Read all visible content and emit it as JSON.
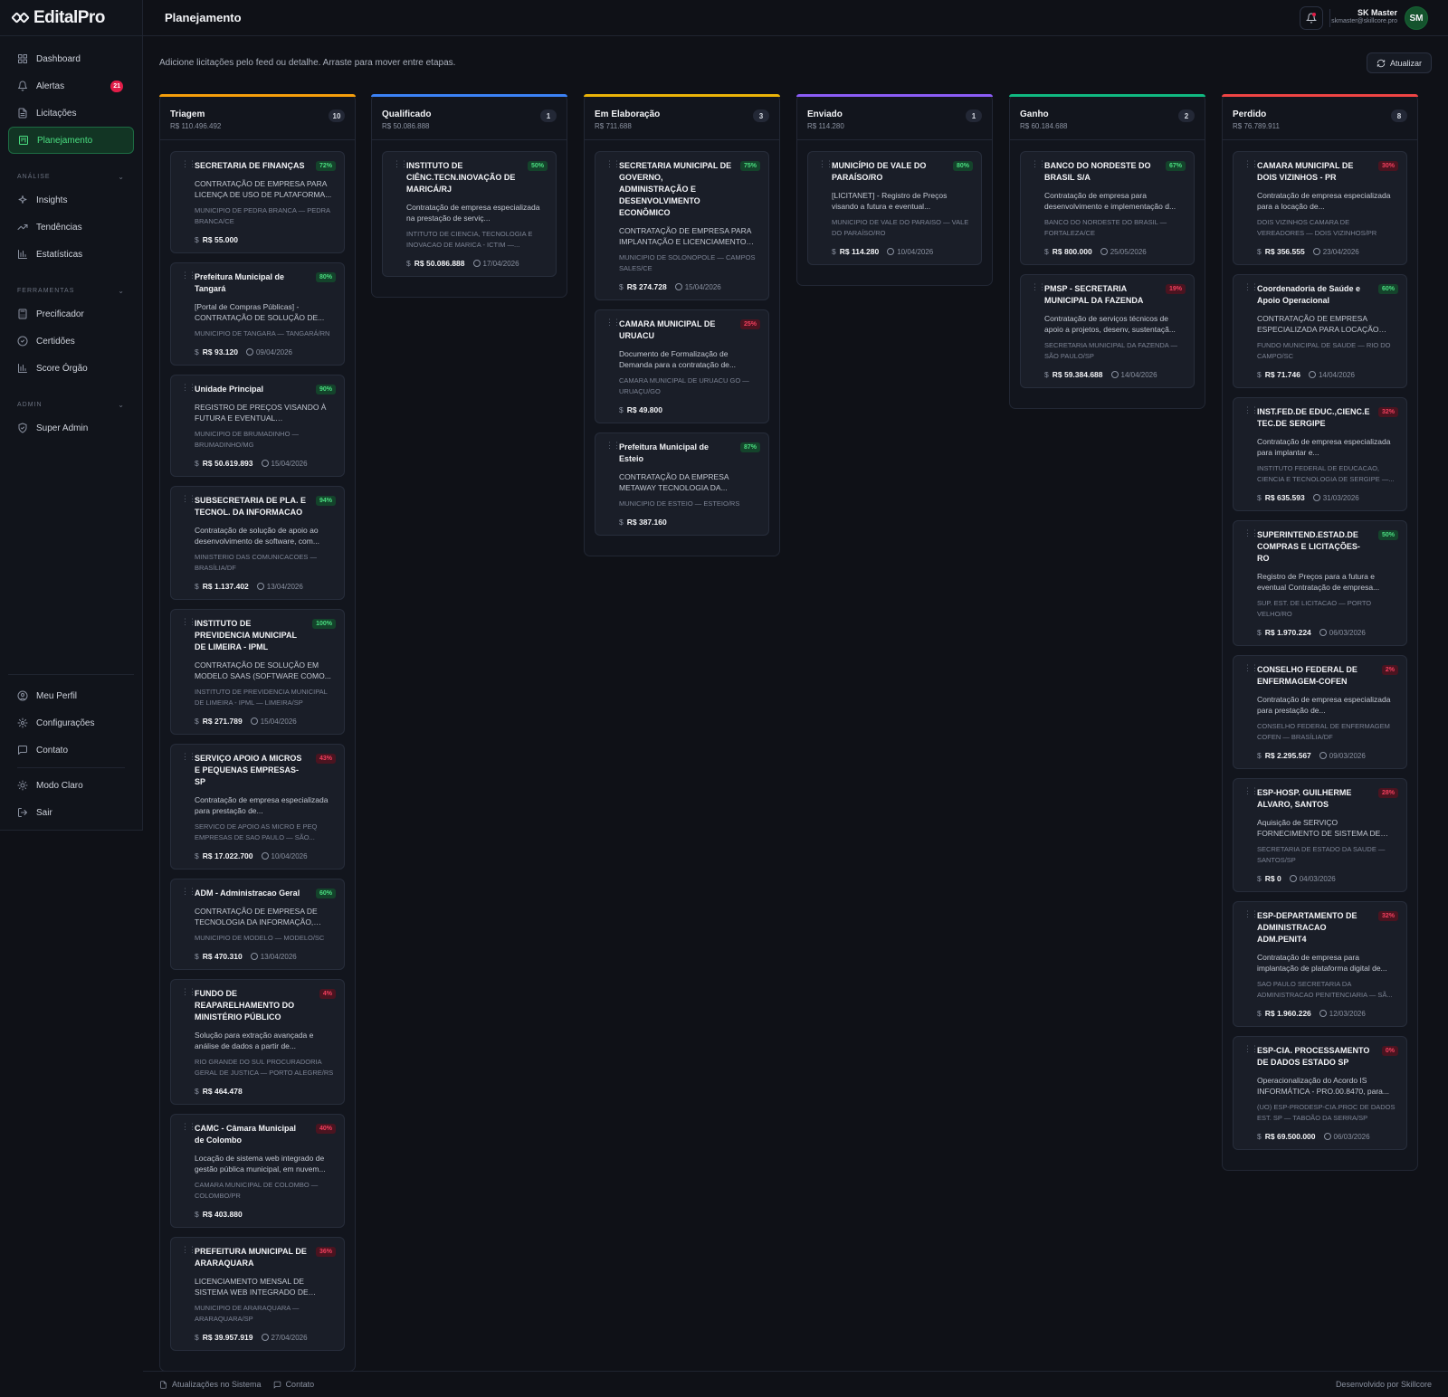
{
  "app": {
    "logo_text": "EditalPro",
    "page_title": "Planejamento"
  },
  "sidebar": {
    "main_items": [
      {
        "label": "Dashboard",
        "icon": "grid-icon"
      },
      {
        "label": "Alertas",
        "icon": "bell-icon",
        "badge": "21"
      },
      {
        "label": "Licitações",
        "icon": "document-icon"
      },
      {
        "label": "Planejamento",
        "icon": "kanban-icon",
        "active": true
      }
    ],
    "analise_title": "ANÁLISE",
    "analise_items": [
      {
        "label": "Insights",
        "icon": "sparkle-icon"
      },
      {
        "label": "Tendências",
        "icon": "trend-icon"
      },
      {
        "label": "Estatísticas",
        "icon": "bar-chart-icon"
      }
    ],
    "ferramentas_title": "FERRAMENTAS",
    "ferramentas_items": [
      {
        "label": "Precificador",
        "icon": "calculator-icon"
      },
      {
        "label": "Certidões",
        "icon": "check-circle-icon"
      },
      {
        "label": "Score Órgão",
        "icon": "bar-chart-icon"
      }
    ],
    "admin_title": "ADMIN",
    "admin_items": [
      {
        "label": "Super Admin",
        "icon": "shield-icon"
      }
    ],
    "bottom_items": [
      {
        "label": "Meu Perfil",
        "icon": "user-circle-icon"
      },
      {
        "label": "Configurações",
        "icon": "gear-icon"
      },
      {
        "label": "Contato",
        "icon": "message-icon"
      }
    ],
    "bottom_items_2": [
      {
        "label": "Modo Claro",
        "icon": "sun-icon"
      },
      {
        "label": "Sair",
        "icon": "logout-icon"
      }
    ]
  },
  "header": {
    "user_name": "SK Master",
    "user_email": "skmaster@skillcore.pro",
    "avatar_initials": "SM"
  },
  "main": {
    "subtitle": "Adicione licitações pelo feed ou detalhe. Arraste para mover entre etapas.",
    "refresh_label": "Atualizar"
  },
  "columns": [
    {
      "name": "Triagem",
      "total": "R$ 110.496.492",
      "count": "10",
      "color": "#f59e0b",
      "cards": [
        {
          "title": "SECRETARIA DE FINANÇAS",
          "pct": "72%",
          "tone": "g",
          "desc": "CONTRATAÇÃO DE EMPRESA PARA LICENÇA DE USO DE PLATAFORMA...",
          "org": "MUNICIPIO DE PEDRA BRANCA — PEDRA BRANCA/CE",
          "value": "R$ 55.000",
          "date": ""
        },
        {
          "title": "Prefeitura Municipal de Tangará",
          "pct": "80%",
          "tone": "g",
          "desc": "[Portal de Compras Públicas] - CONTRATAÇÃO DE SOLUÇÃO DE...",
          "org": "MUNICIPIO DE TANGARA — TANGARÁ/RN",
          "value": "R$ 93.120",
          "date": "09/04/2026"
        },
        {
          "title": "Unidade Principal",
          "pct": "90%",
          "tone": "g",
          "desc": "REGISTRO DE PREÇOS VISANDO À FUTURA E EVENTUAL CONTRATAÇÃO...",
          "org": "MUNICIPIO DE BRUMADINHO — BRUMADINHO/MG",
          "value": "R$ 50.619.893",
          "date": "15/04/2026"
        },
        {
          "title": "SUBSECRETARIA DE PLA. E TECNOL. DA INFORMACAO",
          "pct": "94%",
          "tone": "g",
          "desc": "Contratação de solução de apoio ao desenvolvimento de software, com...",
          "org": "MINISTERIO DAS COMUNICACOES — BRASÍLIA/DF",
          "value": "R$ 1.137.402",
          "date": "13/04/2026"
        },
        {
          "title": "INSTITUTO DE PREVIDENCIA MUNICIPAL DE LIMEIRA - IPML",
          "pct": "100%",
          "tone": "g",
          "desc": "CONTRATAÇÃO DE SOLUÇÃO EM MODELO SAAS (SOFTWARE COMO...",
          "org": "INSTITUTO DE PREVIDENCIA MUNICIPAL DE LIMEIRA - IPML — LIMEIRA/SP",
          "value": "R$ 271.789",
          "date": "15/04/2026"
        },
        {
          "title": "SERVIÇO APOIO A MICROS E PEQUENAS EMPRESAS-SP",
          "pct": "43%",
          "tone": "r",
          "desc": "Contratação de empresa especializada para prestação de...",
          "org": "SERVICO DE APOIO AS MICRO E PEQ EMPRESAS DE SAO PAULO — SÃO...",
          "value": "R$ 17.022.700",
          "date": "10/04/2026"
        },
        {
          "title": "ADM - Administracao Geral",
          "pct": "60%",
          "tone": "g",
          "desc": "CONTRATAÇÃO DE EMPRESA DE TECNOLOGIA DA INFORMAÇÃO, PARA...",
          "org": "MUNICIPIO DE MODELO — MODELO/SC",
          "value": "R$ 470.310",
          "date": "13/04/2026"
        },
        {
          "title": "FUNDO DE REAPARELHAMENTO DO MINISTÉRIO PÚBLICO",
          "pct": "4%",
          "tone": "r",
          "desc": "Solução para extração avançada e análise de dados a partir de...",
          "org": "RIO GRANDE DO SUL PROCURADORIA GERAL DE JUSTICA — PORTO ALEGRE/RS",
          "value": "R$ 464.478",
          "date": ""
        },
        {
          "title": "CAMC - Câmara Municipal de Colombo",
          "pct": "40%",
          "tone": "r",
          "desc": "Locação de sistema web integrado de gestão pública municipal, em nuvem...",
          "org": "CAMARA MUNICIPAL DE COLOMBO — COLOMBO/PR",
          "value": "R$ 403.880",
          "date": ""
        },
        {
          "title": "PREFEITURA MUNICIPAL DE ARARAQUARA",
          "pct": "36%",
          "tone": "r",
          "desc": "LICENCIAMENTO MENSAL DE SISTEMA WEB INTEGRADO DE GESTÃO PÚBLIC...",
          "org": "MUNICIPIO DE ARARAQUARA — ARARAQUARA/SP",
          "value": "R$ 39.957.919",
          "date": "27/04/2026"
        }
      ]
    },
    {
      "name": "Qualificado",
      "total": "R$ 50.086.888",
      "count": "1",
      "color": "#3b82f6",
      "cards": [
        {
          "title": "INSTITUTO DE CIÊNC.TECN.INOVAÇÃO DE MARICÁ/RJ",
          "pct": "50%",
          "tone": "g",
          "desc": "Contratação de empresa especializada na prestação de serviç...",
          "org": "INTITUTO DE CIENCIA, TECNOLOGIA E INOVACAO DE MARICA - ICTIM —...",
          "value": "R$ 50.086.888",
          "date": "17/04/2026"
        }
      ]
    },
    {
      "name": "Em Elaboração",
      "total": "R$ 711.688",
      "count": "3",
      "color": "#eab308",
      "cards": [
        {
          "title": "SECRETARIA MUNICIPAL DE GOVERNO, ADMINISTRAÇÃO E DESENVOLVIMENTO ECONÔMICO",
          "pct": "75%",
          "tone": "g",
          "desc": "CONTRATAÇÃO DE EMPRESA PARA IMPLANTAÇÃO E LICENCIAMENTO DE...",
          "org": "MUNICIPIO DE SOLONOPOLE — CAMPOS SALES/CE",
          "value": "R$ 274.728",
          "date": "15/04/2026"
        },
        {
          "title": "CAMARA MUNICIPAL DE URUACU",
          "pct": "25%",
          "tone": "r",
          "desc": "Documento de Formalização de Demanda para a contratação de...",
          "org": "CAMARA MUNICIPAL DE URUACU GO — URUAÇU/GO",
          "value": "R$ 49.800",
          "date": ""
        },
        {
          "title": "Prefeitura Municipal de Esteio",
          "pct": "87%",
          "tone": "g",
          "desc": "CONTRATAÇÃO DA EMPRESA METAWAY TECNOLOGIA DA...",
          "org": "MUNICIPIO DE ESTEIO — ESTEIO/RS",
          "value": "R$ 387.160",
          "date": ""
        }
      ]
    },
    {
      "name": "Enviado",
      "total": "R$ 114.280",
      "count": "1",
      "color": "#8b5cf6",
      "cards": [
        {
          "title": "MUNICÍPIO DE VALE DO PARAÍSO/RO",
          "pct": "80%",
          "tone": "g",
          "desc": "[LICITANET] - Registro de Preços visando a futura e eventual...",
          "org": "MUNICIPIO DE VALE DO PARAISO — VALE DO PARAÍSO/RO",
          "value": "R$ 114.280",
          "date": "10/04/2026"
        }
      ]
    },
    {
      "name": "Ganho",
      "total": "R$ 60.184.688",
      "count": "2",
      "color": "#10b981",
      "cards": [
        {
          "title": "BANCO DO NORDESTE DO BRASIL S/A",
          "pct": "67%",
          "tone": "g",
          "desc": "Contratação de empresa para desenvolvimento e implementação d...",
          "org": "BANCO DO NORDESTE DO BRASIL — FORTALEZA/CE",
          "value": "R$ 800.000",
          "date": "25/05/2026"
        },
        {
          "title": "PMSP - SECRETARIA MUNICIPAL DA FAZENDA",
          "pct": "19%",
          "tone": "r",
          "desc": "Contratação de serviços técnicos de apoio a projetos, desenv, sustentaçã...",
          "org": "SECRETARIA MUNICIPAL DA FAZENDA — SÃO PAULO/SP",
          "value": "R$ 59.384.688",
          "date": "14/04/2026"
        }
      ]
    },
    {
      "name": "Perdido",
      "total": "R$ 76.789.911",
      "count": "8",
      "color": "#ef4444",
      "cards": [
        {
          "title": "CAMARA MUNICIPAL DE DOIS VIZINHOS - PR",
          "pct": "30%",
          "tone": "r",
          "desc": "Contratação de empresa especializada para a locação de...",
          "org": "DOIS VIZINHOS CAMARA DE VEREADORES — DOIS VIZINHOS/PR",
          "value": "R$ 356.555",
          "date": "23/04/2026"
        },
        {
          "title": "Coordenadoria de Saúde e Apoio Operacional",
          "pct": "60%",
          "tone": "g",
          "desc": "CONTRATAÇÃO DE EMPRESA ESPECIALIZADA PARA LOCAÇÃO DE...",
          "org": "FUNDO MUNICIPAL DE SAUDE — RIO DO CAMPO/SC",
          "value": "R$ 71.746",
          "date": "14/04/2026"
        },
        {
          "title": "INST.FED.DE EDUC.,CIENC.E TEC.DE SERGIPE",
          "pct": "32%",
          "tone": "r",
          "desc": "Contratação de empresa especializada para implantar e...",
          "org": "INSTITUTO FEDERAL DE EDUCACAO, CIENCIA E TECNOLOGIA DE SERGIPE —...",
          "value": "R$ 635.593",
          "date": "31/03/2026"
        },
        {
          "title": "SUPERINTEND.ESTAD.DE COMPRAS E LICITAÇÕES-RO",
          "pct": "50%",
          "tone": "g",
          "desc": "Registro de Preços para a futura e eventual Contratação de empresa...",
          "org": "SUP. EST. DE LICITACAO — PORTO VELHO/RO",
          "value": "R$ 1.970.224",
          "date": "06/03/2026"
        },
        {
          "title": "CONSELHO FEDERAL DE ENFERMAGEM-COFEN",
          "pct": "2%",
          "tone": "r",
          "desc": "Contratação de empresa especializada para prestação de...",
          "org": "CONSELHO FEDERAL DE ENFERMAGEM COFEN — BRASÍLIA/DF",
          "value": "R$ 2.295.567",
          "date": "09/03/2026"
        },
        {
          "title": "ESP-HOSP. GUILHERME ALVARO, SANTOS",
          "pct": "28%",
          "tone": "r",
          "desc": "Aquisição de SERVIÇO FORNECIMENTO DE SISTEMA DE GESTÃO HOSPITALAR",
          "org": "SECRETARIA DE ESTADO DA SAUDE — SANTOS/SP",
          "value": "R$ 0",
          "date": "04/03/2026"
        },
        {
          "title": "ESP-DEPARTAMENTO DE ADMINISTRACAO ADM.PENIT4",
          "pct": "32%",
          "tone": "r",
          "desc": "Contratação de empresa para implantação de plataforma digital de...",
          "org": "SAO PAULO SECRETARIA DA ADMINISTRACAO PENITENCIARIA — SÃ...",
          "value": "R$ 1.960.226",
          "date": "12/03/2026"
        },
        {
          "title": "ESP-CIA. PROCESSAMENTO DE DADOS ESTADO SP",
          "pct": "0%",
          "tone": "r",
          "desc": "Operacionalização do Acordo IS INFORMÁTICA - PRO.00.8470, para...",
          "org": "(UO) ESP-PRODESP-CIA.PROC DE DADOS EST. SP — TABOÃO DA SERRA/SP",
          "value": "R$ 69.500.000",
          "date": "06/03/2026"
        }
      ]
    }
  ],
  "footer": {
    "updates_label": "Atualizações no Sistema",
    "contact_label": "Contato",
    "credit": "Desenvolvido por Skillcore"
  }
}
